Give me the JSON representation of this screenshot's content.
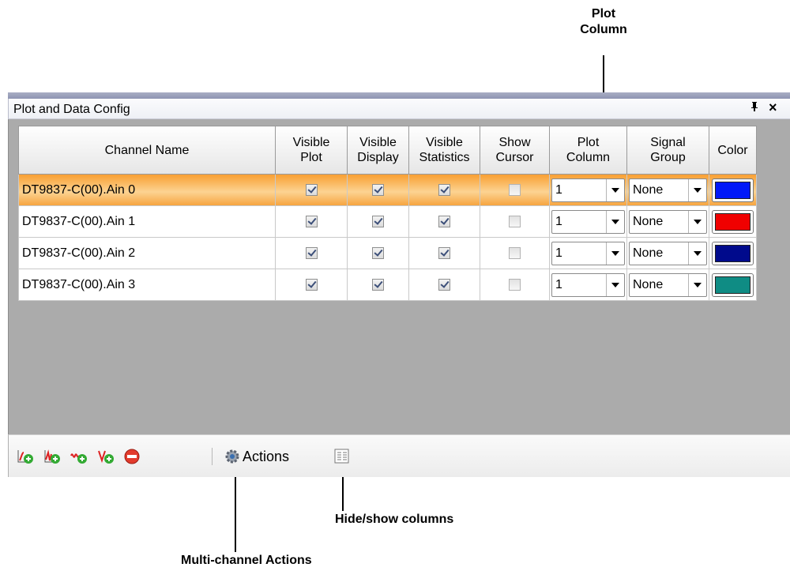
{
  "callouts": {
    "plot_column": [
      "Plot",
      "Column"
    ],
    "hide_show_columns": "Hide/show columns",
    "multi_channel_actions": "Multi-channel Actions"
  },
  "panel": {
    "title": "Plot and Data Config",
    "pin_glyph": "ᵖ",
    "close_glyph": "×"
  },
  "table": {
    "headers": [
      [
        "Channel Name"
      ],
      [
        "Visible",
        "Plot"
      ],
      [
        "Visible",
        "Display"
      ],
      [
        "Visible",
        "Statistics"
      ],
      [
        "Show",
        "Cursor"
      ],
      [
        "Plot",
        "Column"
      ],
      [
        "Signal",
        "Group"
      ],
      [
        "Color"
      ]
    ],
    "rows": [
      {
        "name": "DT9837-C(00).Ain 0",
        "visible_plot": true,
        "visible_display": true,
        "visible_statistics": true,
        "show_cursor": false,
        "plot_column": "1",
        "signal_group": "None",
        "color": "#0018f8",
        "selected": true
      },
      {
        "name": "DT9837-C(00).Ain 1",
        "visible_plot": true,
        "visible_display": true,
        "visible_statistics": true,
        "show_cursor": false,
        "plot_column": "1",
        "signal_group": "None",
        "color": "#f00000",
        "selected": false
      },
      {
        "name": "DT9837-C(00).Ain 2",
        "visible_plot": true,
        "visible_display": true,
        "visible_statistics": true,
        "show_cursor": false,
        "plot_column": "1",
        "signal_group": "None",
        "color": "#000a8c",
        "selected": false
      },
      {
        "name": "DT9837-C(00).Ain 3",
        "visible_plot": true,
        "visible_display": true,
        "visible_statistics": true,
        "show_cursor": false,
        "plot_column": "1",
        "signal_group": "None",
        "color": "#0f8c84",
        "selected": false
      }
    ]
  },
  "toolbar": {
    "icons": [
      "add-plot-icon",
      "add-xy-plot-icon",
      "add-fft-plot-icon",
      "add-vector-plot-icon",
      "remove-icon"
    ],
    "actions_label": "Actions",
    "actions_icon": "gear-icon",
    "columns_icon": "columns-icon"
  }
}
